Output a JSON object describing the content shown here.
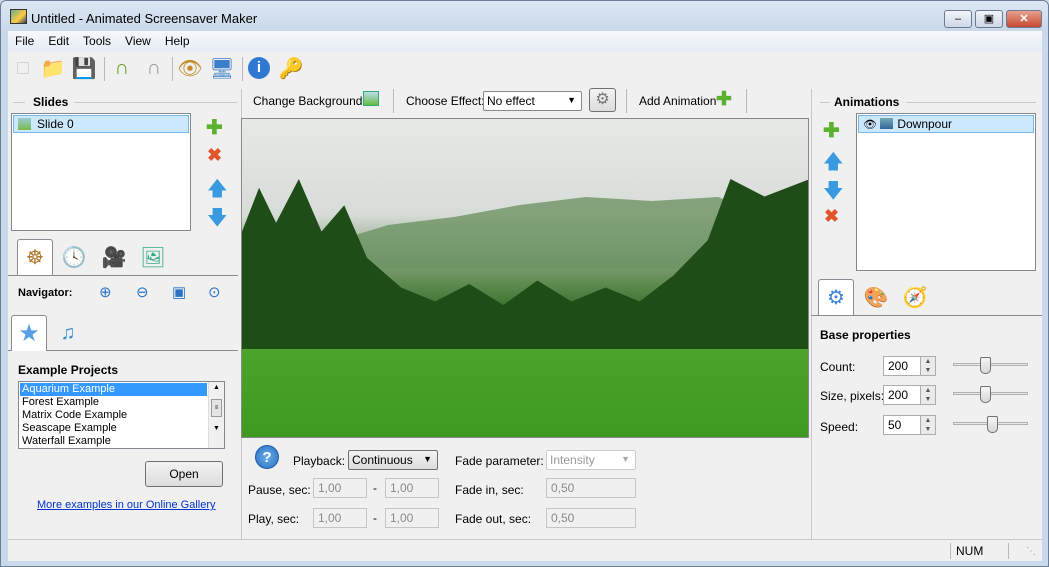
{
  "window": {
    "title": "Untitled - Animated Screensaver Maker",
    "controls": [
      "minimize",
      "maximize",
      "close"
    ]
  },
  "menu": [
    "File",
    "Edit",
    "Tools",
    "View",
    "Help"
  ],
  "toolbar": [
    "new-file",
    "open-folder",
    "save",
    "undo",
    "redo",
    "preview-eye",
    "run-screensaver",
    "about-info",
    "register-key"
  ],
  "slides": {
    "title": "Slides",
    "items": [
      "Slide 0"
    ],
    "selected": 0
  },
  "left_tabs": [
    "wheel",
    "clock",
    "camera",
    "image-info"
  ],
  "navigator": {
    "label": "Navigator:",
    "buttons": [
      "zoom-in",
      "zoom-out",
      "fit",
      "zoom-reset"
    ]
  },
  "example_tabs": [
    "star",
    "music"
  ],
  "examples": {
    "title": "Example Projects",
    "items": [
      "Aquarium Example",
      "Forest Example",
      "Matrix Code Example",
      "Seascape Example",
      "Waterfall Example"
    ],
    "selected": 0,
    "open_label": "Open",
    "gallery_link": "More examples in our Online Gallery"
  },
  "center_toolbar": {
    "change_background": "Change Background",
    "choose_effect_label": "Choose Effect:",
    "effect_value": "No effect",
    "add_animation": "Add Animation"
  },
  "playback": {
    "label": "Playback:",
    "value": "Continuous",
    "pause_label": "Pause, sec:",
    "pause_from": "1,00",
    "pause_to": "1,00",
    "play_label": "Play, sec:",
    "play_from": "1,00",
    "play_to": "1,00",
    "dash": "-",
    "fade_param_label": "Fade parameter:",
    "fade_param_value": "Intensity",
    "fade_in_label": "Fade in, sec:",
    "fade_in": "0,50",
    "fade_out_label": "Fade out, sec:",
    "fade_out": "0,50"
  },
  "animations": {
    "title": "Animations",
    "items": [
      "Downpour"
    ],
    "selected": 0
  },
  "right_tabs": [
    "gears",
    "palette",
    "compass"
  ],
  "base_properties": {
    "title": "Base properties",
    "count_label": "Count:",
    "count": "200",
    "count_slider": 0.42,
    "size_label": "Size, pixels:",
    "size": "200",
    "size_slider": 0.42,
    "speed_label": "Speed:",
    "speed": "50",
    "speed_slider": 0.52
  },
  "status": {
    "num": "NUM"
  }
}
